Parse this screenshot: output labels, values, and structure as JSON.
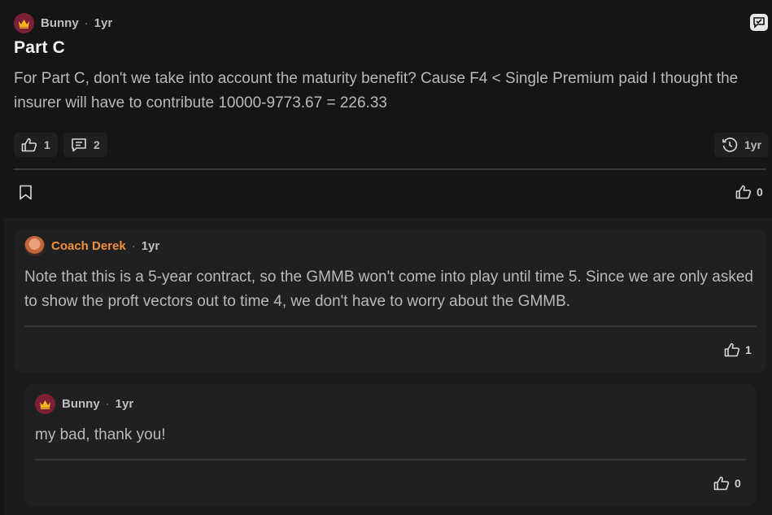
{
  "post": {
    "author": "Bunny",
    "separator": "·",
    "time": "1yr",
    "title": "Part C",
    "body": "For Part C, don't we take into account the maturity benefit? Cause F4 < Single Premium paid I thought the insurer will have to contribute 10000-9773.67 = 226.33",
    "like_count": "1",
    "comment_count": "2",
    "history_time": "1yr",
    "bottom_like_count": "0"
  },
  "replies": [
    {
      "author": "Coach Derek",
      "separator": "·",
      "time": "1yr",
      "body": "Note that this is a 5-year contract, so the GMMB won't come into play until time 5. Since we are only asked to show the proft vectors out to time 4, we don't have to worry about the GMMB.",
      "like_count": "1"
    },
    {
      "author": "Bunny",
      "separator": "·",
      "time": "1yr",
      "body": "my bad, thank you!",
      "like_count": "0"
    }
  ],
  "colors": {
    "background": "#151515",
    "card": "#202020",
    "coach_name": "#f1903b",
    "crown_avatar": "#7c1f34"
  },
  "icons": [
    "crown-icon",
    "edit-icon",
    "thumbs-up-icon",
    "comment-icon",
    "history-icon",
    "bookmark-icon"
  ]
}
